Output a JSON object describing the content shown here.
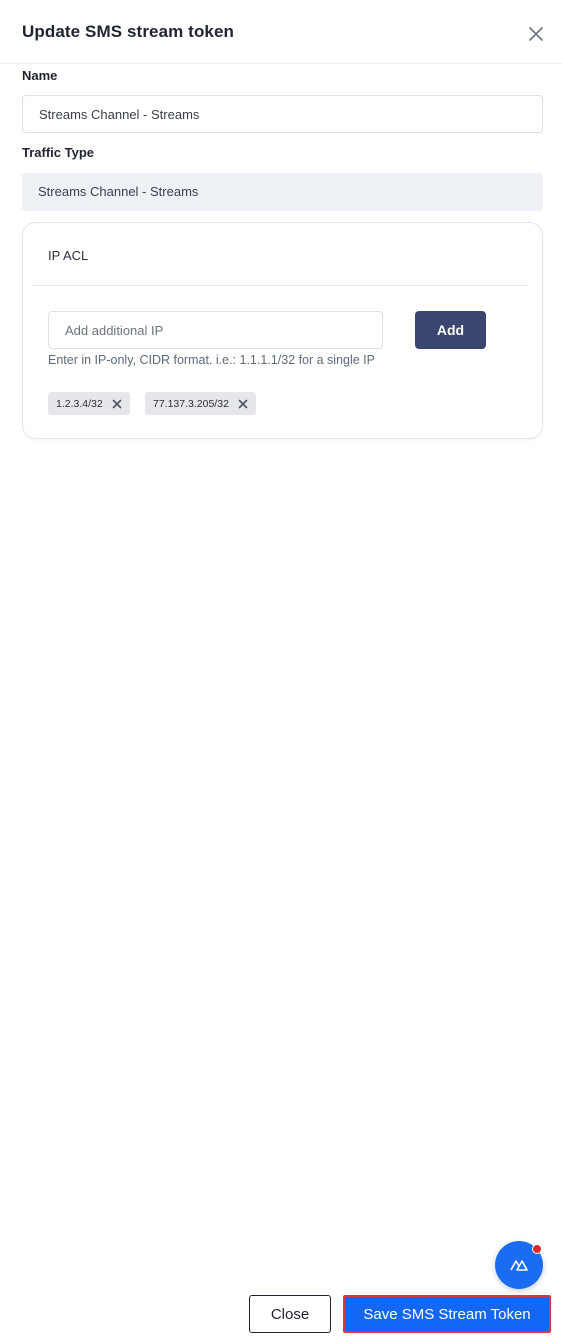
{
  "modal": {
    "title": "Update SMS stream token",
    "close_icon": "close-icon"
  },
  "form": {
    "name_label": "Name",
    "name_value": "Streams Channel - Streams",
    "traffic_type_label": "Traffic Type",
    "traffic_type_value": "Streams Channel - Streams"
  },
  "ip_acl": {
    "title": "IP ACL",
    "input_placeholder": "Add additional IP",
    "add_button": "Add",
    "hint": "Enter in IP-only, CIDR format. i.e.: 1.1.1.1/32 for a single IP",
    "chips": [
      "1.2.3.4/32",
      "77.137.3.205/32"
    ]
  },
  "fab": {
    "icon": "assistant-icon",
    "badge_color": "#e5252a"
  },
  "footer": {
    "close_button": "Close",
    "save_button": "Save SMS Stream Token"
  },
  "colors": {
    "primary": "#1467f5",
    "add_button": "#3b4670",
    "highlight_border": "#e03444"
  }
}
